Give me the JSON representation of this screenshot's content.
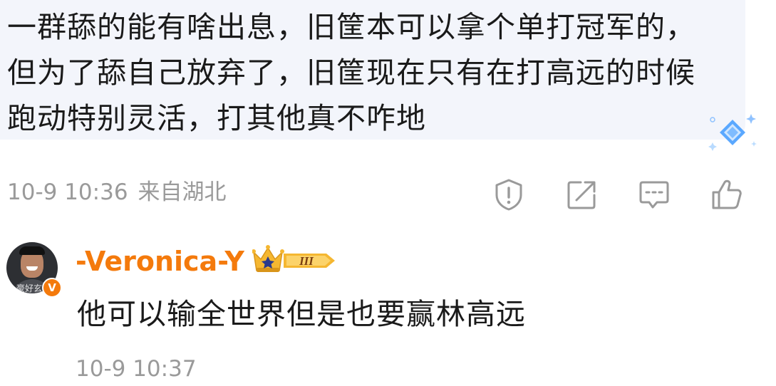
{
  "comment": {
    "text": "一群舔的能有啥出息，旧筐本可以拿个单打冠军的，但为了舔自己放弃了，旧筐现在只有在打高远的时候跑动特别灵活，打其他真不咋地",
    "time": "10-9 10:36",
    "location": "来自湖北",
    "actions": [
      {
        "icon": "report-icon"
      },
      {
        "icon": "share-icon"
      },
      {
        "icon": "reply-icon"
      },
      {
        "icon": "like-icon"
      }
    ]
  },
  "reply": {
    "username": "-Veronica-Y",
    "level_badge": "III",
    "avatar_watermark": "豪好玄",
    "verified_badge": "V",
    "text": "他可以输全世界但是也要赢林高远",
    "time": "10-9 10:37"
  },
  "colors": {
    "username": "#f47a0c",
    "meta_text": "#9a9a9a",
    "bubble_bg": "#f3f5fb",
    "badge_gold": "#f5b731",
    "diamond_blue": "#5aa8ff"
  }
}
